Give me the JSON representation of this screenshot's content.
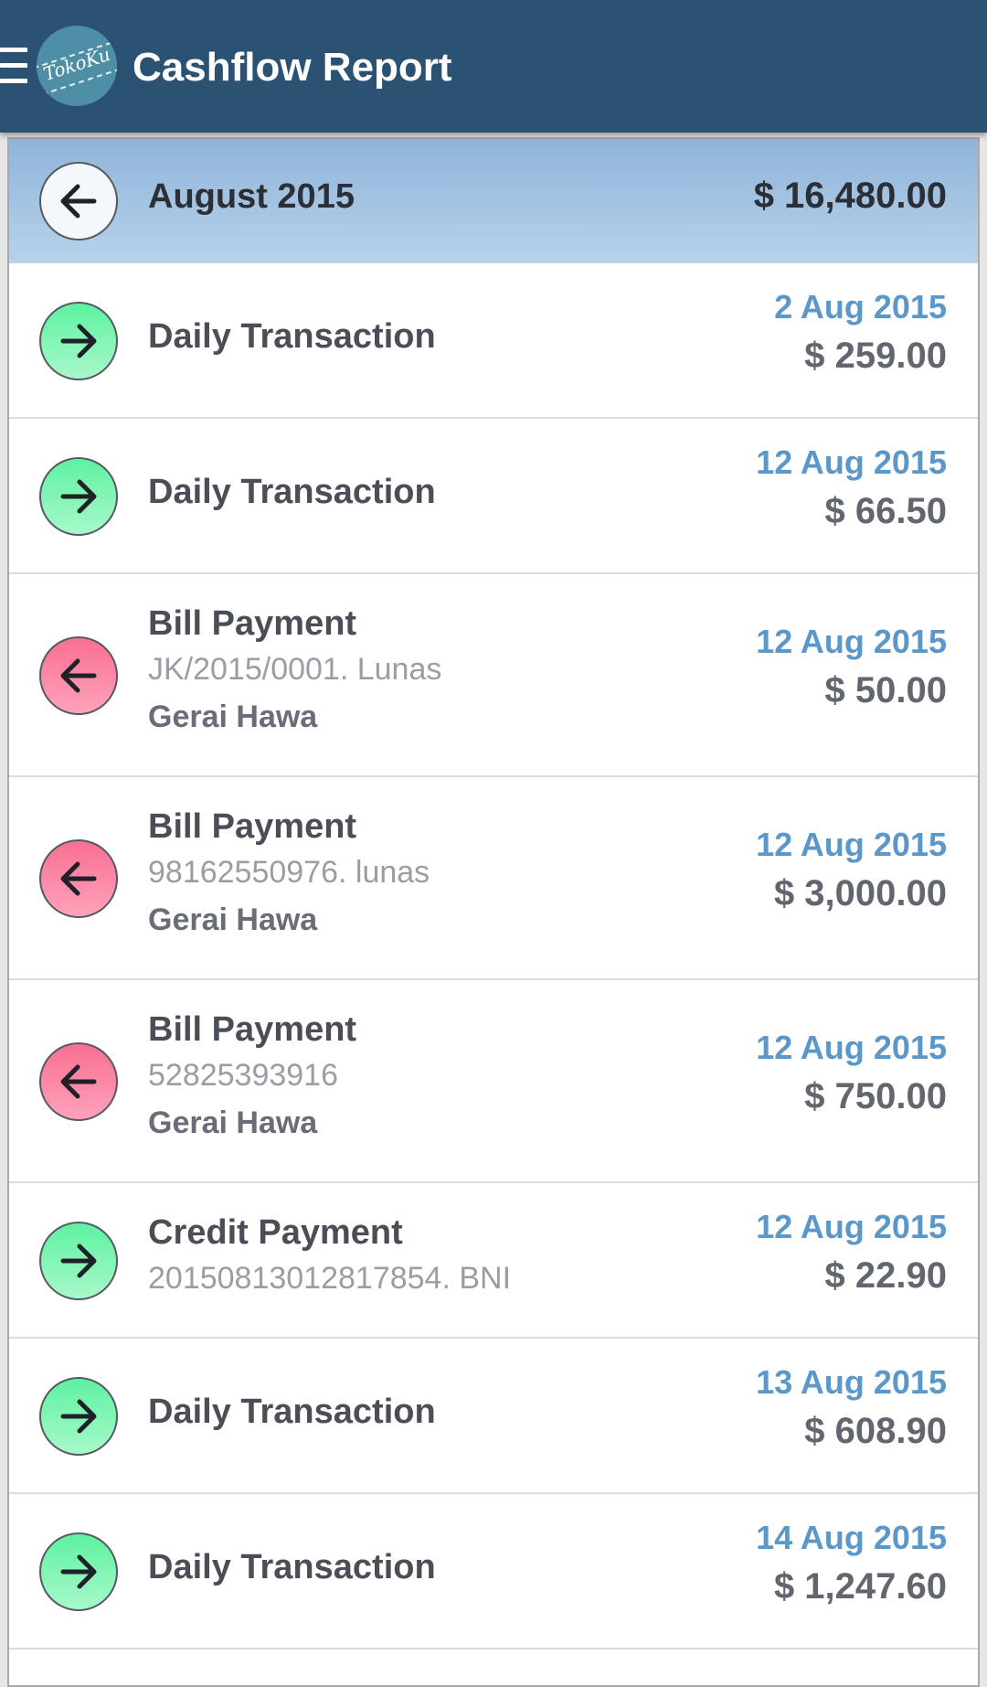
{
  "appbar": {
    "menu_icon": "hamburger-menu-icon",
    "logo_text": "TokoKu",
    "title": "Cashflow Report"
  },
  "month": {
    "icon": "arrow-left-icon",
    "label": "August 2015",
    "total": "$ 16,480.00"
  },
  "colors": {
    "appbar": "#2b5173",
    "income_icon": "#5ef2a2",
    "expense_icon": "#f96f92",
    "date_text": "#5c97c9"
  },
  "transactions": [
    {
      "direction": "in",
      "icon": "arrow-right-icon",
      "title": "Daily Transaction",
      "ref": "",
      "party": "",
      "date": "2 Aug 2015",
      "amount": "$ 259.00"
    },
    {
      "direction": "in",
      "icon": "arrow-right-icon",
      "title": "Daily Transaction",
      "ref": "",
      "party": "",
      "date": "12 Aug 2015",
      "amount": "$ 66.50"
    },
    {
      "direction": "out",
      "icon": "arrow-left-icon",
      "title": "Bill Payment",
      "ref": "JK/2015/0001. Lunas",
      "party": "Gerai Hawa",
      "date": "12 Aug 2015",
      "amount": "$ 50.00"
    },
    {
      "direction": "out",
      "icon": "arrow-left-icon",
      "title": "Bill Payment",
      "ref": "98162550976. lunas",
      "party": "Gerai Hawa",
      "date": "12 Aug 2015",
      "amount": "$ 3,000.00"
    },
    {
      "direction": "out",
      "icon": "arrow-left-icon",
      "title": "Bill Payment",
      "ref": "52825393916",
      "party": "Gerai Hawa",
      "date": "12 Aug 2015",
      "amount": "$ 750.00"
    },
    {
      "direction": "in",
      "icon": "arrow-right-icon",
      "title": "Credit Payment",
      "ref": "20150813012817854. BNI",
      "party": "",
      "date": "12 Aug 2015",
      "amount": "$ 22.90"
    },
    {
      "direction": "in",
      "icon": "arrow-right-icon",
      "title": "Daily Transaction",
      "ref": "",
      "party": "",
      "date": "13 Aug 2015",
      "amount": "$ 608.90"
    },
    {
      "direction": "in",
      "icon": "arrow-right-icon",
      "title": "Daily Transaction",
      "ref": "",
      "party": "",
      "date": "14 Aug 2015",
      "amount": "$ 1,247.60"
    }
  ]
}
